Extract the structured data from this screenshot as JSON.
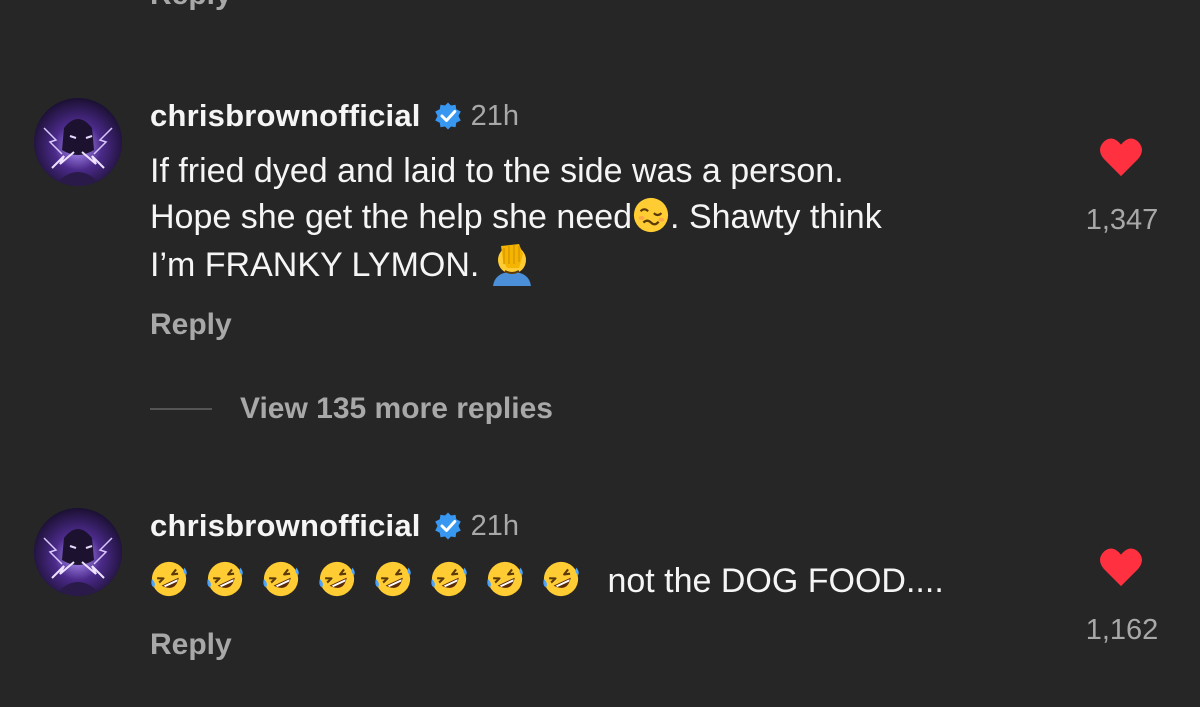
{
  "top_reply_label": "Reply",
  "comments": [
    {
      "username": "chrisbrownofficial",
      "time": "21h",
      "text_line1": "If fried dyed and laid to the side was a person.",
      "text_line2a": "Hope she get the help she need",
      "text_line2b": ". Shawty think",
      "text_line3": "I’m FRANKY LYMON. ",
      "reply_label": "Reply",
      "likes": "1,347",
      "liked_color": "#ff3040"
    },
    {
      "username": "chrisbrownofficial",
      "time": "21h",
      "text_after_emojis": " not the DOG FOOD....",
      "emoji_count": 8,
      "reply_label": "Reply",
      "likes": "1,162",
      "liked_color": "#ff3040"
    }
  ],
  "view_replies_label": "View 135 more replies",
  "icons": {
    "verified": "verified-badge-icon",
    "like": "heart-icon",
    "emoji1": "woozy-face-emoji",
    "emoji2": "facepalm-emoji",
    "emoji3": "rolling-on-floor-laughing-emoji"
  },
  "colors": {
    "background": "#262626",
    "primary_text": "#f5f5f5",
    "secondary_text": "#a8a8a8",
    "verified_blue": "#3897f0"
  }
}
